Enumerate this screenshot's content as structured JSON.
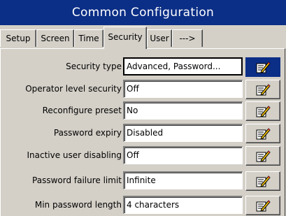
{
  "window": {
    "title": "Common Configuration"
  },
  "tabs": [
    {
      "label": "Setup",
      "active": false
    },
    {
      "label": "Screen",
      "active": false
    },
    {
      "label": "Time",
      "active": false
    },
    {
      "label": "Security",
      "active": true
    },
    {
      "label": "User",
      "active": false
    },
    {
      "label": "--->",
      "active": false
    }
  ],
  "rows": [
    {
      "label": "Security type",
      "value": "Advanced, Password...",
      "selected": true,
      "button_icon": "edit-icon"
    },
    {
      "label": "Operator level security",
      "value": "Off",
      "selected": false,
      "button_icon": "edit-icon"
    },
    {
      "label": "Reconfigure preset",
      "value": "No",
      "selected": false,
      "button_icon": "edit-icon"
    },
    {
      "label": "Password expiry",
      "value": "Disabled",
      "selected": false,
      "button_icon": "edit-icon"
    },
    {
      "label": "Inactive user disabling",
      "value": "Off",
      "selected": false,
      "button_icon": "edit-icon"
    },
    {
      "label": "Password failure limit",
      "value": "Infinite",
      "selected": false,
      "button_icon": "edit-icon"
    },
    {
      "label": "Min password length",
      "value": "4 characters",
      "selected": false,
      "button_icon": "edit-icon"
    }
  ],
  "colors": {
    "titlebar": "#0b2e86",
    "panel": "#d4d0c8",
    "selected_button": "#0b2e86"
  }
}
